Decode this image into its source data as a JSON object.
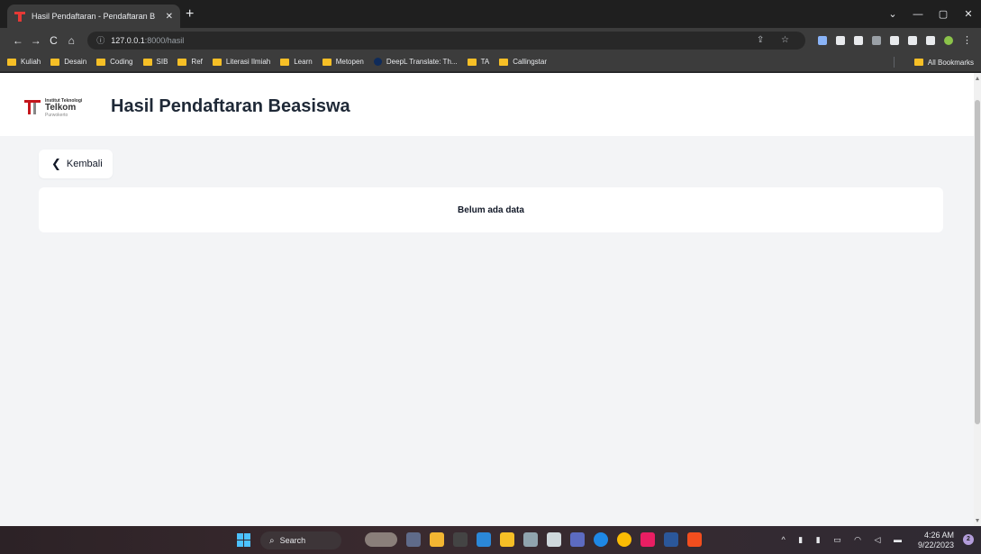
{
  "browser": {
    "tab_title": "Hasil Pendaftaran - Pendaftaran B",
    "tab_close": "✕",
    "new_tab": "+",
    "window_controls": {
      "dropdown": "⌄",
      "minimize": "—",
      "maximize": "▢",
      "close": "✕"
    },
    "nav": {
      "back": "←",
      "forward": "→",
      "reload": "C",
      "home": "⌂"
    },
    "url_host": "127.0.0.1",
    "url_path": ":8000/hasil",
    "omnibox_actions": "⇪ ☆",
    "bookmarks": [
      {
        "label": "Kuliah",
        "type": "folder"
      },
      {
        "label": "Desain",
        "type": "folder"
      },
      {
        "label": "Coding",
        "type": "folder"
      },
      {
        "label": "SIB",
        "type": "folder"
      },
      {
        "label": "Ref",
        "type": "folder"
      },
      {
        "label": "Literasi Ilmiah",
        "type": "folder"
      },
      {
        "label": "Learn",
        "type": "folder"
      },
      {
        "label": "Metopen",
        "type": "folder"
      },
      {
        "label": "DeepL Translate: Th...",
        "type": "site"
      },
      {
        "label": "TA",
        "type": "folder"
      },
      {
        "label": "Callingstar",
        "type": "folder"
      }
    ],
    "all_bookmarks": "All Bookmarks"
  },
  "page": {
    "logo": {
      "line1": "Institut Teknologi",
      "line2": "Telkom",
      "line3": "Purwokerto"
    },
    "title": "Hasil Pendaftaran Beasiswa",
    "back_label": "Kembali",
    "back_chevron": "❮",
    "empty_message": "Belum ada data"
  },
  "taskbar": {
    "search_label": "Search",
    "search_icon": "⌕",
    "tray_icons": "^ ▮ ▮ ▭ ◠ ◁ ▬",
    "time": "4:26 AM",
    "date": "9/22/2023",
    "notification_count": "2"
  },
  "colors": {
    "page_bg": "#f3f4f6",
    "card_bg": "#ffffff",
    "folder": "#f6bf26",
    "telkom_red": "#c4161c"
  }
}
